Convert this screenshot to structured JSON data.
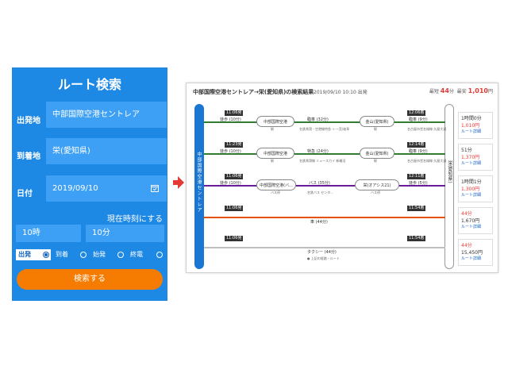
{
  "search": {
    "title": "ルート検索",
    "from_label": "出発地",
    "from_value": "中部国際空港セントレア",
    "to_label": "到着地",
    "to_value": "栄(愛知県)",
    "date_label": "日付",
    "date_value": "2019/09/10",
    "now_link": "現在時刻にする",
    "hour_value": "10時",
    "minute_value": "10分",
    "modes": [
      "出発",
      "到着",
      "始発",
      "終電"
    ],
    "selected_mode": "出発",
    "search_button": "検索する"
  },
  "results": {
    "heading": "中部国際空港セントレア→栄(愛知県)の検索結果",
    "datetime": "2019/09/10 10:10 出発",
    "fastest_label": "最短",
    "fastest_value": "44",
    "fastest_unit": "分",
    "cheapest_label": "最安",
    "cheapest_value": "1,010",
    "cheapest_unit": "円",
    "start_station": "中部国際空港セントレア",
    "end_station": "栄(愛知県)",
    "routes": [
      {
        "start_time": "11:06発",
        "end_time": "12:06着",
        "color": "#2e7d32",
        "walk": "徒歩 (10分)",
        "station1": "中部国際空港",
        "station1_sub": "駅",
        "train": "臨車 (32分)",
        "train_sub": "名鉄常滑・空港線特急 → 一宮/岐阜",
        "station2": "金山(愛知県)",
        "station2_sub": "駅",
        "last": "臨車 (9分)",
        "last_sub": "名古屋市営名城線 久屋大通",
        "duration": "1時間0分",
        "fare": "1,010円",
        "detail": "ルート詳細"
      },
      {
        "start_time": "11:23発",
        "end_time": "12:14着",
        "color": "#2e7d32",
        "walk": "徒歩 (10分)",
        "station1": "中部国際空港",
        "station1_sub": "駅",
        "train": "特急 (24分)",
        "train_sub": "名鉄常滑線 ミュースカイ 新鵜沼",
        "station2": "金山(愛知県)",
        "station2_sub": "駅",
        "last": "臨車 (9分)",
        "last_sub": "名古屋市営名城線 久屋大通",
        "duration": "51分",
        "fare": "1,370円",
        "detail": "ルート詳細"
      },
      {
        "start_time": "11:06発",
        "end_time": "12:11着",
        "color": "#6a1b9a",
        "walk": "徒歩 (10分)",
        "station1": "中部国際空港(バ...",
        "station1_sub": "バス停",
        "train": "バス (35分)",
        "train_sub": "名鉄バス センタ...",
        "station2": "栄(オアシス21)",
        "station2_sub": "バス停",
        "last": "徒歩 (5分)",
        "last_sub": "",
        "duration": "1時間1分",
        "fare": "1,300円",
        "detail": "ルート詳細"
      },
      {
        "start_time": "11:06発",
        "end_time": "11:54着",
        "color": "#e65100",
        "car": "車 (44分)",
        "duration": "44分",
        "fare": "1,670円",
        "detail": "ルート詳細"
      },
      {
        "start_time": "11:06発",
        "end_time": "11:54着",
        "color": "#bdbdbd",
        "taxi": "タクシー (44分)",
        "taxi_sub": "● 上記の経路・ルート",
        "duration": "44分",
        "fare": "15,450円",
        "detail": "ルート詳細"
      }
    ]
  },
  "colors": {
    "panel": "#1e88e5",
    "field": "#3da0f5",
    "button": "#f57c00",
    "arrow": "#e53935"
  }
}
